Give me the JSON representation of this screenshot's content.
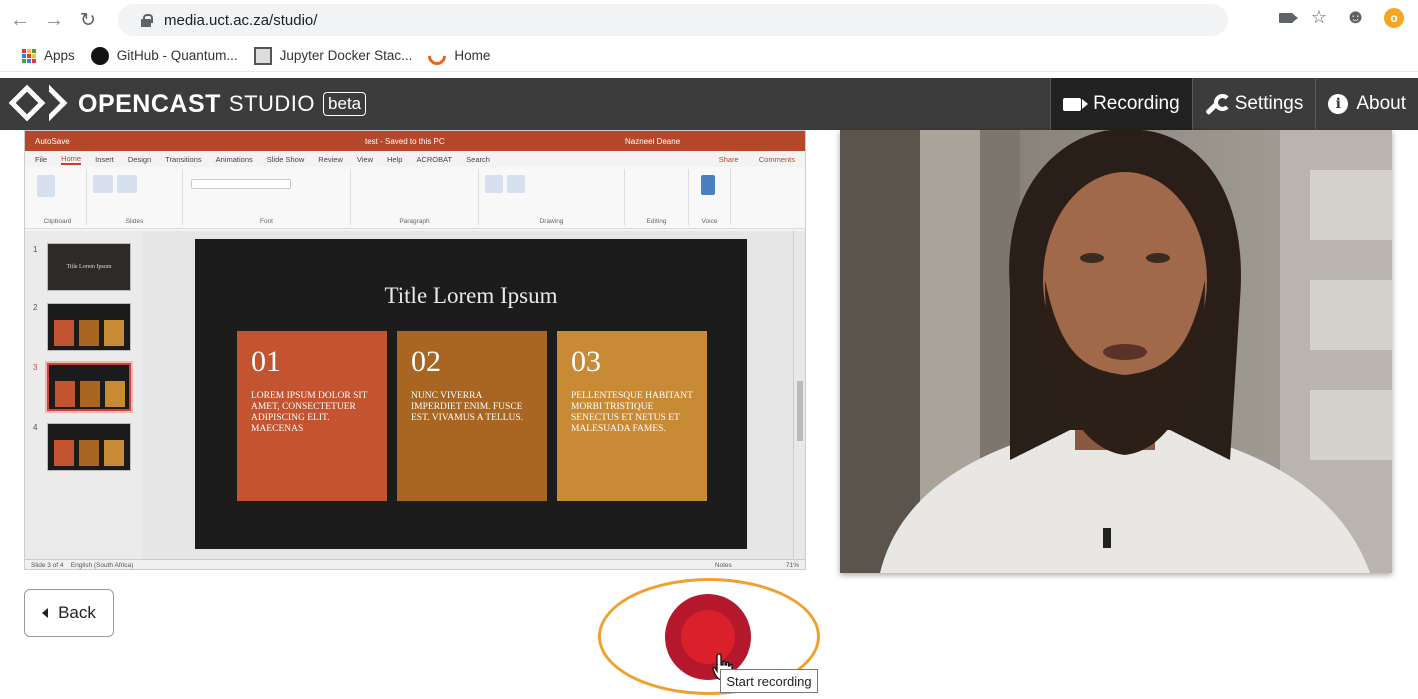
{
  "browser": {
    "url": "media.uct.ac.za/studio/",
    "bookmarks": [
      {
        "label": "Apps"
      },
      {
        "label": "GitHub - Quantum..."
      },
      {
        "label": "Jupyter Docker Stac..."
      },
      {
        "label": "Home"
      }
    ]
  },
  "app": {
    "brand_name": "OPENCAST",
    "brand_studio": "STUDIO",
    "brand_beta": "beta",
    "nav": {
      "recording": "Recording",
      "settings": "Settings",
      "about": "About"
    }
  },
  "screen_preview": {
    "window_title": "test - Saved to this PC",
    "autosave": "AutoSave",
    "user": "Nazneel Deane",
    "ribbon_tabs": [
      "File",
      "Home",
      "Insert",
      "Design",
      "Transitions",
      "Animations",
      "Slide Show",
      "Review",
      "View",
      "Help",
      "ACROBAT",
      "Search"
    ],
    "share": "Share",
    "comments": "Comments",
    "ribbon_groups": [
      "Clipboard",
      "Slides",
      "Font",
      "Paragraph",
      "Drawing",
      "Editing",
      "Voice"
    ],
    "thumb_numbers": [
      "1",
      "2",
      "3",
      "4"
    ],
    "thumb_title": "Title Lorem Ipsum",
    "slide_title": "Title Lorem Ipsum",
    "boxes": [
      {
        "num": "01",
        "text": "LOREM IPSUM DOLOR SIT AMET, CONSECTETUER ADIPISCING ELIT. MAECENAS",
        "color": "#c4532f"
      },
      {
        "num": "02",
        "text": "NUNC VIVERRA IMPERDIET ENIM. FUSCE EST. VIVAMUS A TELLUS.",
        "color": "#a86622"
      },
      {
        "num": "03",
        "text": "PELLENTESQUE HABITANT MORBI TRISTIQUE SENECTUS ET NETUS ET MALESUADA FAMES.",
        "color": "#c98a36"
      }
    ],
    "status_left": "Slide 3 of 4",
    "status_lang": "English (South Africa)",
    "status_notes": "Notes",
    "status_zoom": "71%"
  },
  "controls": {
    "back_label": "Back",
    "tooltip": "Start recording"
  },
  "colors": {
    "header_bg": "#3c3c3c",
    "record": "#d9202b",
    "highlight": "#f0a030"
  }
}
